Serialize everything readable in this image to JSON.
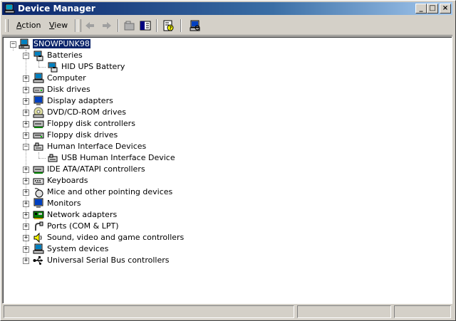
{
  "window": {
    "title": "Device Manager",
    "title_icon": "device-manager-icon",
    "controls": {
      "minimize": "_",
      "maximize": "□",
      "close": "×"
    }
  },
  "menu": [
    {
      "label": "Action",
      "underline": "A",
      "rest": "ction"
    },
    {
      "label": "View",
      "underline": "V",
      "rest": "iew"
    }
  ],
  "toolbar_icons": [
    "back-arrow-icon",
    "forward-arrow-icon",
    "up-folder-icon",
    "show-hide-tree-icon",
    "properties-help-icon",
    "scan-hardware-icon"
  ],
  "tree": {
    "root": {
      "label": "SNOWPUNK98",
      "icon": "computer-icon",
      "expanded": true,
      "selected": true
    },
    "items": [
      {
        "label": "Batteries",
        "icon": "battery-icon",
        "expanded": true,
        "children": [
          {
            "label": "HID UPS Battery",
            "icon": "battery-icon"
          }
        ]
      },
      {
        "label": "Computer",
        "icon": "computer-icon",
        "expanded": false
      },
      {
        "label": "Disk drives",
        "icon": "disk-drive-icon",
        "expanded": false
      },
      {
        "label": "Display adapters",
        "icon": "display-adapter-icon",
        "expanded": false
      },
      {
        "label": "DVD/CD-ROM drives",
        "icon": "cdrom-icon",
        "expanded": false
      },
      {
        "label": "Floppy disk controllers",
        "icon": "floppy-controller-icon",
        "expanded": false
      },
      {
        "label": "Floppy disk drives",
        "icon": "floppy-drive-icon",
        "expanded": false
      },
      {
        "label": "Human Interface Devices",
        "icon": "hid-icon",
        "expanded": true,
        "children": [
          {
            "label": "USB Human Interface Device",
            "icon": "hid-icon"
          }
        ]
      },
      {
        "label": "IDE ATA/ATAPI controllers",
        "icon": "ide-controller-icon",
        "expanded": false
      },
      {
        "label": "Keyboards",
        "icon": "keyboard-icon",
        "expanded": false
      },
      {
        "label": "Mice and other pointing devices",
        "icon": "mouse-icon",
        "expanded": false
      },
      {
        "label": "Monitors",
        "icon": "monitor-icon",
        "expanded": false
      },
      {
        "label": "Network adapters",
        "icon": "network-adapter-icon",
        "expanded": false
      },
      {
        "label": "Ports (COM & LPT)",
        "icon": "port-icon",
        "expanded": false
      },
      {
        "label": "Sound, video and game controllers",
        "icon": "sound-icon",
        "expanded": false
      },
      {
        "label": "System devices",
        "icon": "system-device-icon",
        "expanded": false
      },
      {
        "label": "Universal Serial Bus controllers",
        "icon": "usb-icon",
        "expanded": false
      }
    ]
  },
  "status": {
    "pane1": "",
    "pane2": "",
    "pane3": ""
  },
  "colors": {
    "selection": "#0a246a",
    "title_start": "#0a246a",
    "title_end": "#a6caf0",
    "chrome": "#d4d0c8"
  }
}
